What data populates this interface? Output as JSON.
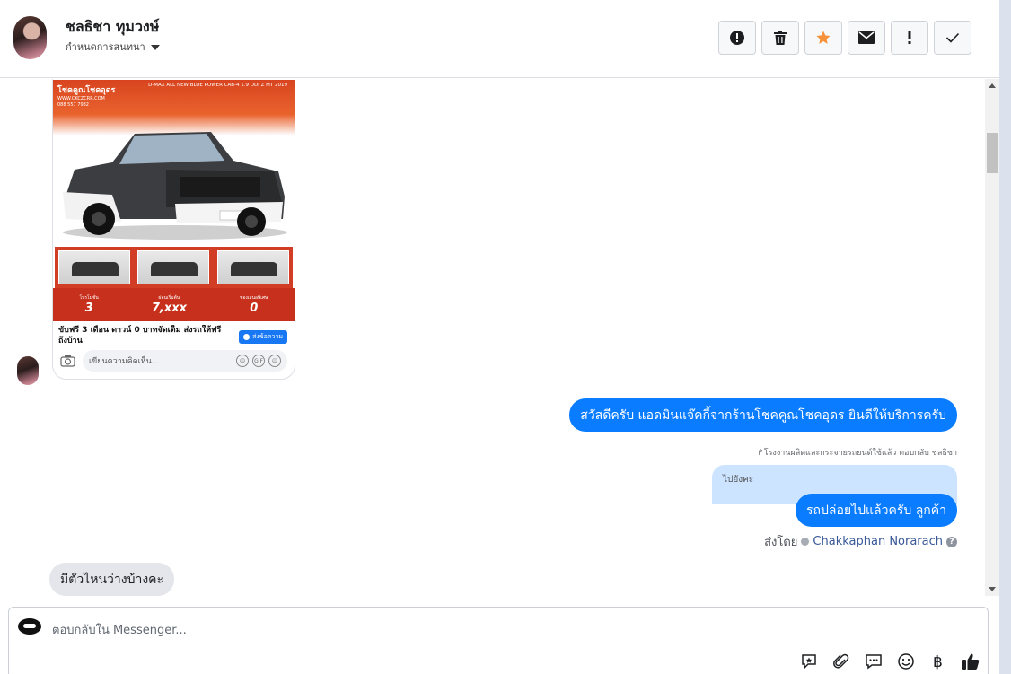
{
  "header": {
    "contact_name": "ชลธิชา ทุมวงษ์",
    "assign_label": "กำหนดการสนทนา",
    "toolbar": [
      {
        "name": "spam-button",
        "icon": "exclamation-circle-icon"
      },
      {
        "name": "delete-button",
        "icon": "trash-icon"
      },
      {
        "name": "star-button",
        "icon": "star-icon",
        "color": "#f7923a"
      },
      {
        "name": "mark-unread-button",
        "icon": "envelope-icon"
      },
      {
        "name": "follow-up-button",
        "icon": "exclamation-icon"
      },
      {
        "name": "done-button",
        "icon": "check-icon"
      }
    ]
  },
  "shared_post": {
    "brand": "โชคคูณโชคอุดร",
    "brand_web": "WWW.CKCZCRR.COM",
    "brand_phone": "088 557 7932",
    "model": "D-MAX ALL NEW BLUE POWER CAB-4 1.9 DDI Z MT 2019",
    "offer1_label": "โปรโมชั่น",
    "offer1_value": "3",
    "offer2_label": "ผ่อนเริ่มต้น",
    "offer2_value": "7,xxx",
    "offer3_label": "ช่องเสนอพิเศษ",
    "offer3_value": "0",
    "caption": "ขับฟรี 3 เดือน ดาวน์ 0 บาทจัดเต็ม ส่งรถให้ฟรีถึงบ้าน",
    "send_button": "ส่งข้อความ",
    "comment_placeholder": "เขียนความคิดเห็น..."
  },
  "messages": {
    "greeting": "สวัสดีครับ แอดมินแจ๊คกี้จากร้านโชคคูณโชคอุดร ยินดีให้บริการครับ",
    "reply_ref": "โรงงานผลิตและกระจายรถยนต์ใช้แล้ว ตอบกลับ ชลธิชา",
    "quoted_text": "ไปยังคะ",
    "reply": "รถปล่อยไปแล้วครับ ลูกค้า",
    "sent_by_label": "ส่งโดย",
    "sent_by_agent": "Chakkaphan Norarach",
    "incoming": "มีตัวไหนว่างบ้างคะ"
  },
  "composer": {
    "placeholder": "ตอบกลับใน Messenger...",
    "tools": [
      "saved-reply-icon",
      "attachment-icon",
      "chat-bubble-icon",
      "emoji-icon",
      "baht-icon",
      "like-icon"
    ]
  },
  "colors": {
    "outgoing_bubble": "#0a7cff",
    "incoming_bubble": "#e4e6eb",
    "quoted_bubble": "#cce4ff",
    "star": "#f7923a"
  }
}
